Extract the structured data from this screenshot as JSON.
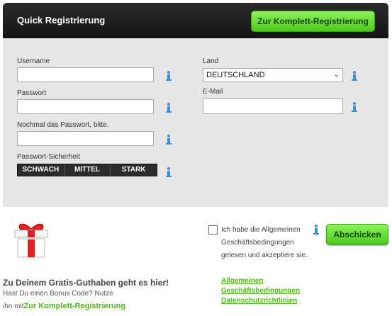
{
  "header": {
    "title": "Quick Registrierung",
    "full_registration_button": "Zur Komplett-Registrierung"
  },
  "form": {
    "username_label": "Username",
    "password_label": "Passwort",
    "password_repeat_label": "Nochmal das Passwort, bitte.",
    "strength_label": "Passwort-Sicherheit",
    "strength_levels": [
      "SCHWACH",
      "MITTEL",
      "STARK"
    ],
    "country_label": "Land",
    "country_value": "DEUTSCHLAND",
    "email_label": "E-Mail"
  },
  "promo": {
    "title": "Zu Deinem Gratis-Guthaben geht es hier!",
    "line1": "Hast Du einen Bonus Code? Nutze",
    "line2_prefix": "ihn mit",
    "line2_link": "Zur Komplett-Registrierung"
  },
  "terms": {
    "checkbox_text": "Ich habe die Allgemeinen Geschäftsbedingungen gelesen und akzeptiere sie.",
    "link_agb_1": "Allgemeinen",
    "link_agb_2": "Geschäftsbedingungen",
    "link_privacy": "Datenschutzrichtlinien",
    "submit_button": "Abschicken"
  },
  "colors": {
    "accent_green": "#52b81e",
    "info_blue": "#3b8fd6",
    "header_bg": "#1c1c1c"
  }
}
